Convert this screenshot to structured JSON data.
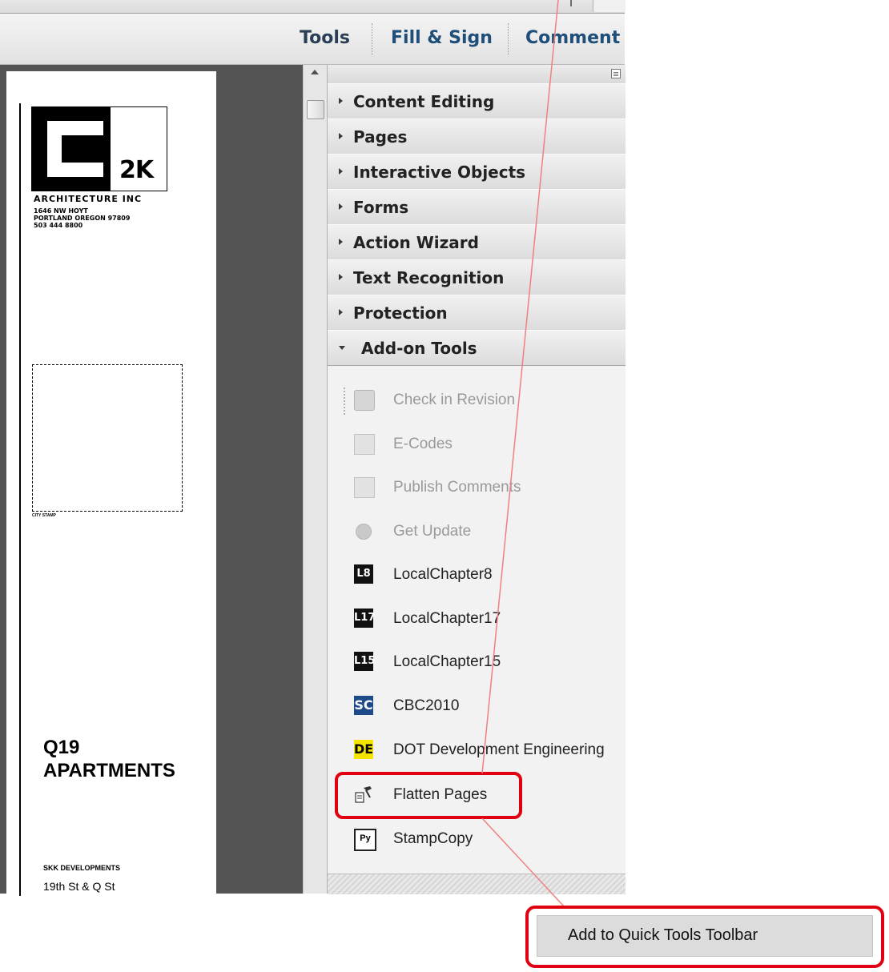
{
  "toolbar": {
    "tools_label": "Tools",
    "fill_sign_label": "Fill & Sign",
    "comment_label": "Comment"
  },
  "document": {
    "logo_text": "2K",
    "firm_name": "ARCHITECTURE INC",
    "firm_address_line1": "1646 NW HOYT",
    "firm_address_line2": "PORTLAND OREGON 97809",
    "firm_phone": "503 444 8800",
    "stamp_label": "CITY STAMP",
    "project_title_line1": "Q19",
    "project_title_line2": "APARTMENTS",
    "developer": "SKK DEVELOPMENTS",
    "address": "19th St & Q St"
  },
  "panel": {
    "sections": [
      {
        "label": "Content Editing"
      },
      {
        "label": "Pages"
      },
      {
        "label": "Interactive Objects"
      },
      {
        "label": "Forms"
      },
      {
        "label": "Action Wizard"
      },
      {
        "label": "Text Recognition"
      },
      {
        "label": "Protection"
      },
      {
        "label": "Add-on Tools"
      }
    ],
    "tools": [
      {
        "label": "Check in Revision",
        "icon": "check-in-revision-icon",
        "disabled": true
      },
      {
        "label": "E-Codes",
        "icon": "e-codes-icon",
        "disabled": true
      },
      {
        "label": "Publish Comments",
        "icon": "publish-comments-icon",
        "disabled": true
      },
      {
        "label": "Get Update",
        "icon": "get-update-icon",
        "disabled": true
      },
      {
        "label": "LocalChapter8",
        "icon": "L8",
        "disabled": false
      },
      {
        "label": "LocalChapter17",
        "icon": "L17",
        "disabled": false
      },
      {
        "label": "LocalChapter15",
        "icon": "L15",
        "disabled": false
      },
      {
        "label": "CBC2010",
        "icon": "SC",
        "disabled": false
      },
      {
        "label": "DOT Development Engineering",
        "icon": "DE",
        "disabled": false
      },
      {
        "label": "Flatten Pages",
        "icon": "flatten-pages-icon",
        "disabled": false
      },
      {
        "label": "StampCopy",
        "icon": "stamp-copy-icon",
        "disabled": false
      }
    ]
  },
  "context_menu": {
    "item_label": "Add to Quick Tools Toolbar"
  },
  "colors": {
    "highlight": "#e0000f",
    "leader_line": "#f08080"
  }
}
